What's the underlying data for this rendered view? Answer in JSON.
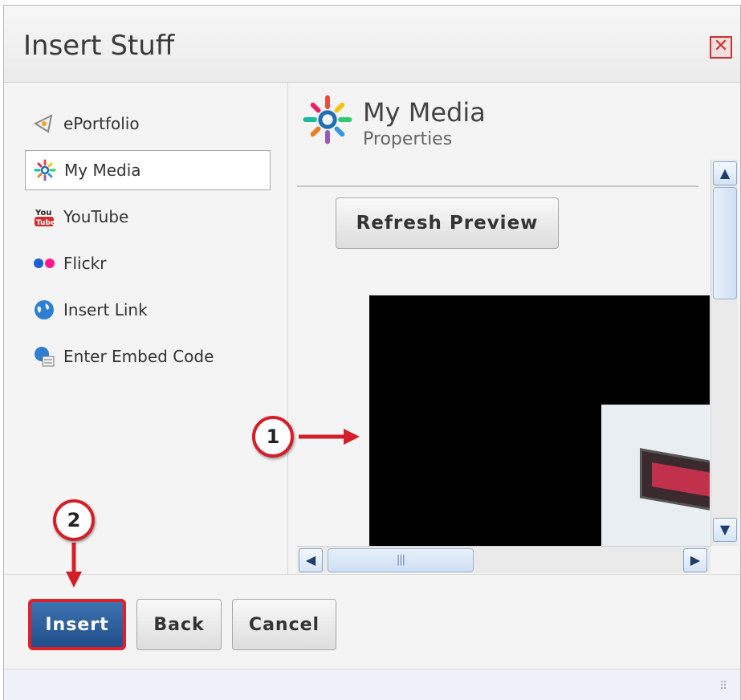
{
  "dialog": {
    "title": "Insert Stuff",
    "close_icon": "close-icon"
  },
  "sidebar": {
    "items": [
      {
        "label": "ePortfolio",
        "icon": "eportfolio-icon",
        "active": false
      },
      {
        "label": "My Media",
        "icon": "my-media-icon",
        "active": true
      },
      {
        "label": "YouTube",
        "icon": "youtube-icon",
        "active": false
      },
      {
        "label": "Flickr",
        "icon": "flickr-icon",
        "active": false
      },
      {
        "label": "Insert Link",
        "icon": "globe-icon",
        "active": false
      },
      {
        "label": "Enter Embed Code",
        "icon": "embed-code-icon",
        "active": false
      }
    ]
  },
  "main": {
    "title": "My Media",
    "subtitle": "Properties",
    "refresh_label": "Refresh Preview"
  },
  "footer": {
    "insert_label": "Insert",
    "back_label": "Back",
    "cancel_label": "Cancel"
  },
  "annotations": {
    "callout_1": "1",
    "callout_2": "2"
  },
  "colors": {
    "accent_blue": "#2d5f9c",
    "highlight_red": "#e0202a"
  }
}
